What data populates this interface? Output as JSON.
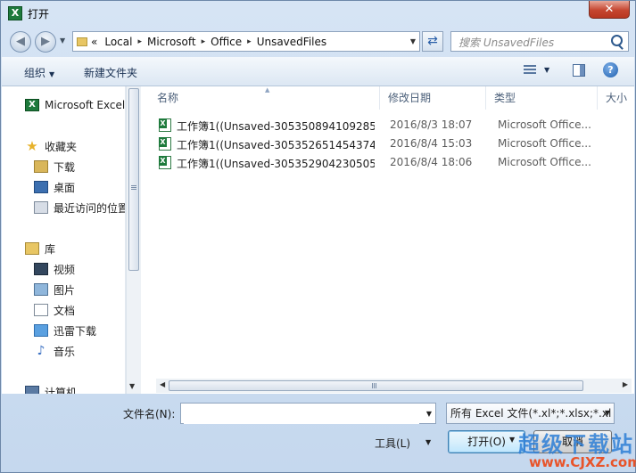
{
  "window": {
    "title": "打开",
    "app_icon_glyph": "X",
    "close_glyph": "✕"
  },
  "nav": {
    "back_glyph": "◀",
    "forward_glyph": "▶",
    "history_glyph": "▼",
    "address_overflow": "«",
    "breadcrumbs": [
      "Local",
      "Microsoft",
      "Office",
      "UnsavedFiles"
    ],
    "separator": "▸",
    "address_drop_glyph": "▼",
    "refresh_glyph": "⇄",
    "search_placeholder": "搜索 UnsavedFiles"
  },
  "toolbar": {
    "organize_label": "组织",
    "new_folder_label": "新建文件夹",
    "dropdown_glyph": "▼",
    "help_glyph": "?"
  },
  "sidebar": {
    "items": [
      {
        "label": "Microsoft Excel",
        "icon": "excel-icon"
      },
      {
        "label": "收藏夹",
        "icon": "star-icon"
      },
      {
        "label": "下载",
        "icon": "download-folder-icon"
      },
      {
        "label": "桌面",
        "icon": "desktop-icon"
      },
      {
        "label": "最近访问的位置",
        "icon": "recent-places-icon"
      },
      {
        "label": "库",
        "icon": "library-icon"
      },
      {
        "label": "视频",
        "icon": "videos-icon"
      },
      {
        "label": "图片",
        "icon": "pictures-icon"
      },
      {
        "label": "文档",
        "icon": "documents-icon"
      },
      {
        "label": "迅雷下载",
        "icon": "thunder-download-icon"
      },
      {
        "label": "音乐",
        "icon": "music-icon"
      },
      {
        "label": "计算机",
        "icon": "computer-icon"
      }
    ],
    "excel_glyph": "X",
    "star_glyph": "★",
    "music_glyph": "♪",
    "scroll_down_glyph": "▼"
  },
  "file_list": {
    "columns": [
      "名称",
      "修改日期",
      "类型",
      "大小"
    ],
    "sort_glyph": "▲",
    "rows": [
      {
        "name": "工作簿1((Unsaved-305350894109285...",
        "date": "2016/8/3 18:07",
        "type": "Microsoft Office..."
      },
      {
        "name": "工作簿1((Unsaved-305352651454374...",
        "date": "2016/8/4 15:03",
        "type": "Microsoft Office..."
      },
      {
        "name": "工作簿1((Unsaved-305352904230505...",
        "date": "2016/8/4 18:06",
        "type": "Microsoft Office..."
      }
    ],
    "scroll_left_glyph": "◀",
    "scroll_right_glyph": "▶"
  },
  "footer": {
    "filename_label": "文件名(N):",
    "filename_value": "",
    "filter_label": "所有 Excel 文件(*.xl*;*.xlsx;*.xl",
    "tools_label": "工具(L)",
    "open_label": "打开(O)",
    "cancel_label": "取消",
    "dropdown_glyph": "▼"
  },
  "watermark": {
    "line1": "超级下载站",
    "line2": "www.CJXZ.com"
  },
  "colors": {
    "accent": "#2a5fa8",
    "excel_green": "#1e7a3c",
    "close_red": "#c5452f"
  }
}
